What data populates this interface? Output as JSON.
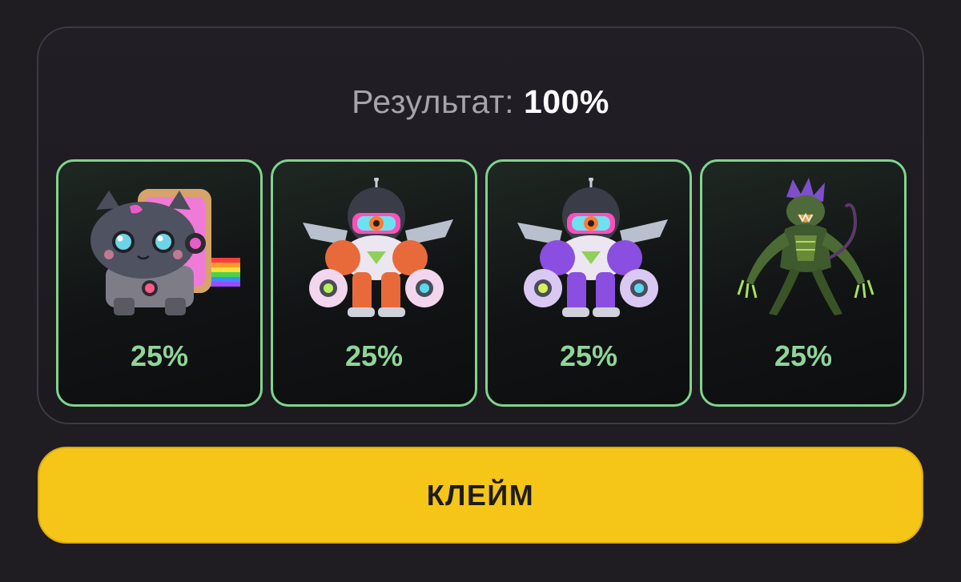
{
  "result": {
    "label": "Результат:",
    "value": "100%"
  },
  "cards": [
    {
      "name": "nyan-cat-robot",
      "icon": "cat-robot-icon",
      "percent": "25%"
    },
    {
      "name": "astronaut-mech-red",
      "icon": "mech-astronaut-red-icon",
      "percent": "25%"
    },
    {
      "name": "astronaut-mech-purple",
      "icon": "mech-astronaut-purple-icon",
      "percent": "25%"
    },
    {
      "name": "alien-monster",
      "icon": "alien-monster-icon",
      "percent": "25%"
    }
  ],
  "claim_button": {
    "label": "КЛЕЙМ"
  },
  "colors": {
    "background": "#1f1c22",
    "card_border": "#7fd48d",
    "percent_text": "#8fd59a",
    "button": "#f5c518"
  }
}
